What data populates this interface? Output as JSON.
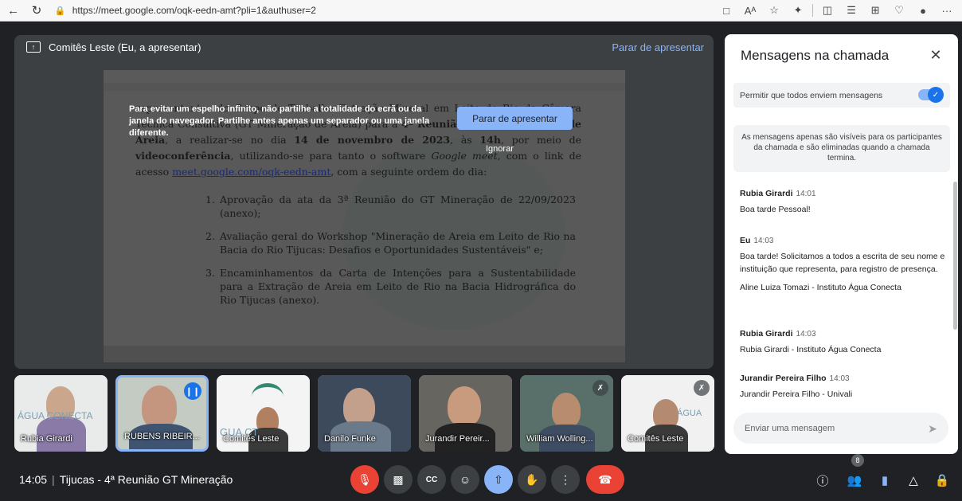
{
  "browser": {
    "url": "https://meet.google.com/oqk-eedn-amt?pli=1&authuser=2",
    "icons": [
      "back-icon",
      "reload-icon",
      "lock-icon",
      "camera-icon",
      "read-aloud-icon",
      "favorite-icon",
      "extensions-icon",
      "split-icon",
      "favorites-list-icon",
      "collections-icon",
      "heart-icon",
      "profile-icon",
      "more-icon"
    ],
    "read_aloud": "Aᴬ",
    "more": "···"
  },
  "presentation": {
    "title": "Comitês Leste (Eu, a apresentar)",
    "stop_link": "Parar de apresentar",
    "warning": "Para evitar um espelho infinito, não partilhe a totalidade do ecrã ou da janela do navegador. Partilhe antes apenas um separador ou uma janela diferente.",
    "stop_button": "Parar de apresentar",
    "ignore": "Ignorar"
  },
  "document": {
    "p1_a": "representantes do Grupo de Trabalho Extração Mineral em Leito de Rio da Câmara Técnica Consultiva (GT Mineração de Areia) para a ",
    "p1_bold1": "4ª Reunião do GT Mineração de Areia",
    "p1_b": ", a realizar-se no dia ",
    "p1_bold2": "14 de novembro de 2023",
    "p1_c": ", às ",
    "p1_bold3": "14h",
    "p1_d": ", por meio de ",
    "p1_bold4": "videoconferência",
    "p1_e": ", utilizando-se para tanto o software ",
    "p1_italic": "Google meet",
    "p1_f": ", com o link de acesso ",
    "p1_link": "meet.google.com/oqk-eedn-amt",
    "p1_g": ", com a seguinte ordem do dia:",
    "items": [
      {
        "num": "1.",
        "text": "Aprovação da ata da 3ª Reunião do GT Mineração de 22/09/2023 (anexo);"
      },
      {
        "num": "2.",
        "text": "Avaliação geral do Workshop \"Mineração de Areia em Leito de Rio na Bacia do Rio Tijucas: Desafios e Oportunidades Sustentáveis\" e;"
      },
      {
        "num": "3.",
        "text": "Encaminhamentos da Carta de Intenções para a Sustentabilidade para a Extração de Areia em Leito de Rio na Bacia Hidrográfica do Rio Tijucas (anexo)."
      }
    ]
  },
  "participants": [
    {
      "name": "Rubia Girardi",
      "bg": "#e9ecea",
      "logo": "ÁGUA CONECTA"
    },
    {
      "name": "RUBENS RIBEIR...",
      "bg": "#c8cfc6",
      "speaking": true
    },
    {
      "name": "Comitês Leste",
      "bg": "#f4f4f4",
      "logo": "GUA CT"
    },
    {
      "name": "Danilo Funke",
      "bg": "#3b4a5e"
    },
    {
      "name": "Jurandir Pereir...",
      "bg": "#6b6a66"
    },
    {
      "name": "William Wolling...",
      "bg": "#5b6f6c",
      "muted": true
    },
    {
      "name": "Comitês Leste",
      "bg": "#f2f2f2",
      "muted": true,
      "logo": "ÁGUA"
    }
  ],
  "meeting": {
    "time": "14:05",
    "title": "Tijucas - 4ª Reunião GT Mineração",
    "participant_count": "8"
  },
  "controls": {
    "icons": [
      "mic-off-icon",
      "camera-off-icon",
      "captions-icon",
      "emoji-icon",
      "present-icon",
      "raise-hand-icon",
      "more-options-icon",
      "leave-call-icon"
    ],
    "captions_glyph": "CC",
    "right_icons": [
      "info-icon",
      "people-icon",
      "chat-icon",
      "activities-icon",
      "host-controls-icon"
    ]
  },
  "chat": {
    "title": "Mensagens na chamada",
    "allow_label": "Permitir que todos enviem mensagens",
    "notice": "As mensagens apenas são visíveis para os participantes da chamada e são eliminadas quando a chamada termina.",
    "messages": [
      {
        "sender": "Rubia Girardi",
        "time": "14:01",
        "lines": [
          "Boa tarde Pessoal!"
        ]
      },
      {
        "sender": "Eu",
        "time": "14:03",
        "lines": [
          "Boa tarde! Solicitamos a todos a escrita de seu nome e instituição que representa, para registro de presença.",
          "Aline Luiza Tomazi - Instituto Água Conecta"
        ]
      },
      {
        "sender": "Rubia Girardi",
        "time": "14:03",
        "lines": [
          "Rubia Girardi - Instituto Água Conecta"
        ]
      },
      {
        "sender": "Jurandir Pereira Filho",
        "time": "14:03",
        "lines": [
          "Jurandir Pereira Filho - Univali"
        ]
      }
    ],
    "input_placeholder": "Enviar uma mensagem"
  }
}
